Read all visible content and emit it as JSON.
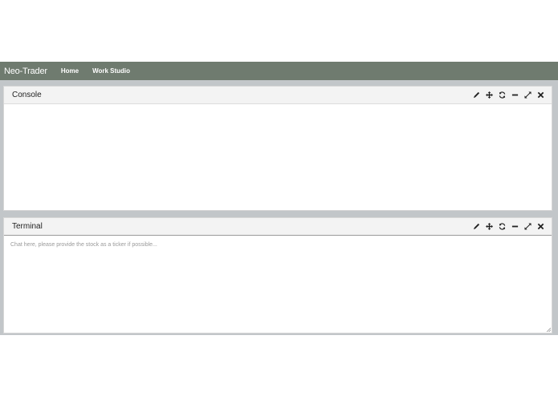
{
  "navbar": {
    "brand": "Neo-Trader",
    "links": [
      {
        "label": "Home"
      },
      {
        "label": "Work Studio"
      }
    ]
  },
  "panels": {
    "console": {
      "title": "Console"
    },
    "terminal": {
      "title": "Terminal",
      "input_value": "",
      "placeholder": "Chat here, please provide the stock as a ticker if possible..."
    }
  },
  "toolbar_icons": [
    "pencil-icon",
    "move-icon",
    "refresh-icon",
    "minimize-icon",
    "maximize-icon",
    "close-icon"
  ],
  "colors": {
    "navbar": "#6f7b6f",
    "workspace": "#c2c6c9",
    "panel_header": "#f3f3f3"
  }
}
